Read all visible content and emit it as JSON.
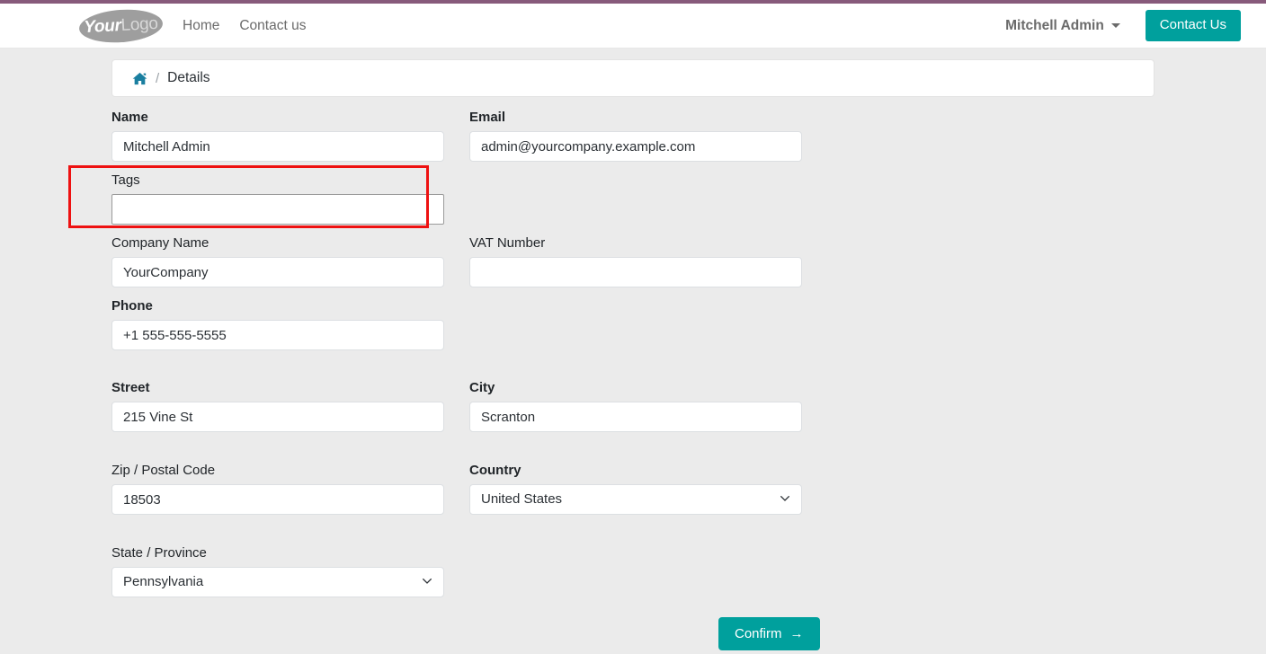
{
  "navbar": {
    "logo": {
      "part1": "Your",
      "part2": "Logo"
    },
    "links": [
      {
        "label": "Home",
        "name": "nav-link-home"
      },
      {
        "label": "Contact us",
        "name": "nav-link-contact-us"
      }
    ],
    "user_menu": "Mitchell Admin",
    "contact_button": "Contact Us"
  },
  "breadcrumb": {
    "home_icon": "home-icon",
    "separator": "/",
    "current": "Details"
  },
  "form": {
    "name": {
      "label": "Name",
      "value": "Mitchell Admin"
    },
    "email": {
      "label": "Email",
      "value": "admin@yourcompany.example.com"
    },
    "tags": {
      "label": "Tags",
      "value": "",
      "placeholder": ""
    },
    "company_name": {
      "label": "Company Name",
      "value": "YourCompany"
    },
    "vat_number": {
      "label": "VAT Number",
      "value": "",
      "placeholder": ""
    },
    "phone": {
      "label": "Phone",
      "value": "+1 555-555-5555"
    },
    "street": {
      "label": "Street",
      "value": "215 Vine St"
    },
    "city": {
      "label": "City",
      "value": "Scranton"
    },
    "zip": {
      "label": "Zip / Postal Code",
      "value": "18503"
    },
    "country": {
      "label": "Country",
      "value": "United States"
    },
    "state": {
      "label": "State / Province",
      "value": "Pennsylvania"
    },
    "confirm_button": "Confirm",
    "confirm_arrow": "→"
  },
  "annotation": {
    "type": "red-highlight-box",
    "target": "tags-field"
  },
  "colors": {
    "top_strip": "#875A7B",
    "accent_teal": "#00a09d",
    "page_background": "#ebebeb",
    "annotation_red": "#ee1111",
    "home_icon": "#1a7fa0"
  }
}
